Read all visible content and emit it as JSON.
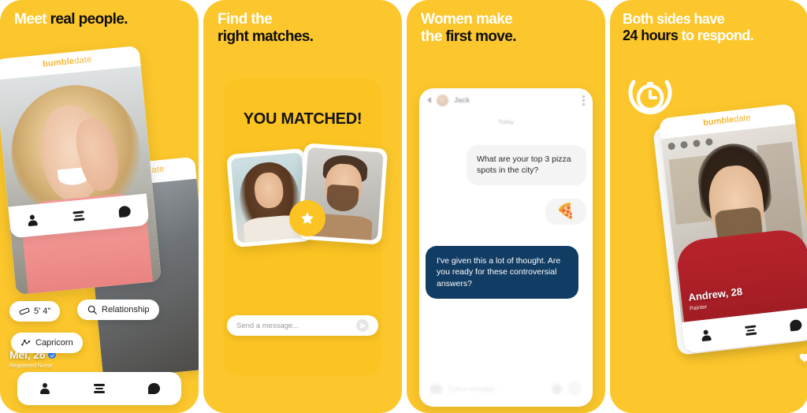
{
  "brand": {
    "name_bold": "bumble",
    "name_light": "date",
    "accent_yellow": "#fcc72c",
    "accent_dark_navy": "#113c63",
    "text_black": "#0d0d0d",
    "text_white": "#ffffff"
  },
  "panels": [
    {
      "id": "meet-real-people",
      "headline": {
        "line1": "Meet ",
        "line1_bold": "real people.",
        "line2": "",
        "line2_bold": ""
      },
      "profile": {
        "name": "Mel, 26",
        "occupation": "Registered Nurse",
        "verified": true,
        "brand_bold": "bumble",
        "brand_light": "date"
      },
      "chips": [
        {
          "icon": "ruler-icon",
          "label": "5' 4\""
        },
        {
          "icon": "search-icon",
          "label": "Relationship"
        },
        {
          "icon": "zodiac-icon",
          "label": "Capricorn"
        }
      ],
      "nav": [
        {
          "icon": "person-icon",
          "label": "Profile"
        },
        {
          "icon": "filter-icon",
          "label": "Discover"
        },
        {
          "icon": "chat-icon",
          "label": "Chat"
        }
      ]
    },
    {
      "id": "find-right-matches",
      "headline": {
        "line1": "Find the",
        "line1_bold": "",
        "line2": "",
        "line2_bold": "right matches."
      },
      "match_title": "YOU MATCHED!",
      "badge_icon": "star-icon",
      "message_input": {
        "placeholder": "Send a message...",
        "value": "",
        "send_icon": "send-icon"
      }
    },
    {
      "id": "women-make-first-move",
      "headline": {
        "line1": "Women make",
        "line1_bold": "",
        "line2": "the ",
        "line2_bold": "first move."
      },
      "chat": {
        "contact_name": "Jack",
        "day_label": "Today",
        "back_icon": "chevron-left-icon",
        "menu_icon": "more-vertical-icon",
        "messages": [
          {
            "from": "them",
            "text": "What are your top 3 pizza spots in the city?"
          },
          {
            "from": "them",
            "text": "🍕"
          },
          {
            "from": "me",
            "text": "I've given this a lot of thought. Are you ready for these controversial answers?"
          }
        ],
        "input": {
          "placeholder": "Type a message...",
          "value": "",
          "camera_icon": "camera-icon"
        }
      }
    },
    {
      "id": "both-sides-24-hours",
      "headline": {
        "line1": "Both sides have",
        "line1_bold": "",
        "line2": "",
        "line2_bold": "24 hours",
        "line2_tail": " to respond."
      },
      "timer_icon": "stopwatch-icon",
      "profile": {
        "name": "Andrew, 28",
        "occupation": "Painter",
        "brand_bold": "bumble",
        "brand_light": "date",
        "like_icon": "heart-hex-icon"
      },
      "nav": [
        {
          "icon": "person-icon",
          "label": "Profile"
        },
        {
          "icon": "filter-icon",
          "label": "Discover"
        },
        {
          "icon": "chat-icon",
          "label": "Chat"
        }
      ]
    }
  ]
}
